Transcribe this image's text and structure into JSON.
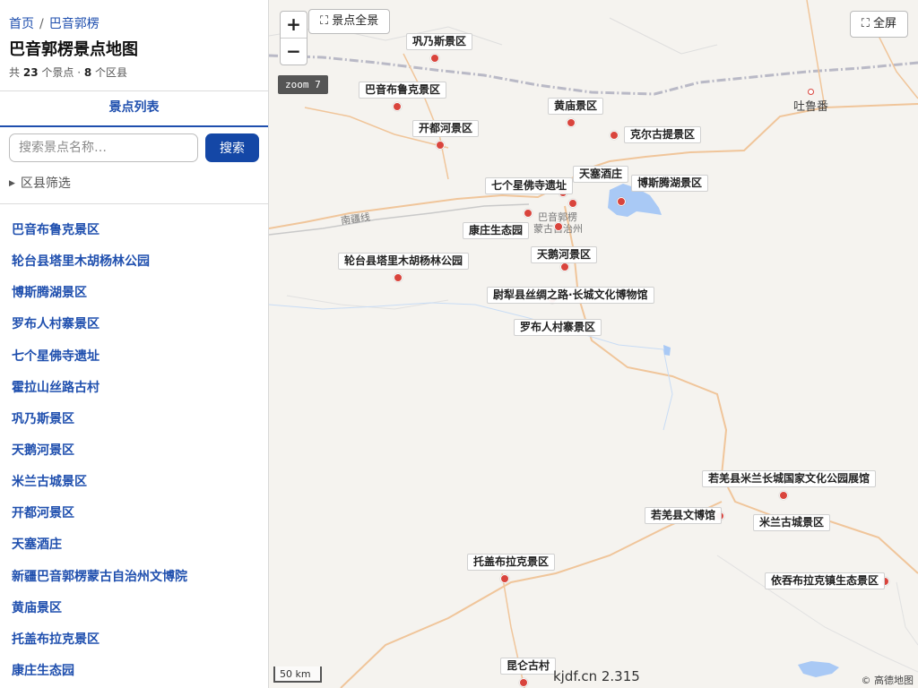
{
  "breadcrumb": {
    "home": "首页",
    "separator": "/",
    "current": "巴音郭楞"
  },
  "page_title": "巴音郭楞景点地图",
  "stats": {
    "prefix": "共",
    "spot_count": "23",
    "spot_unit": "个景点 ·",
    "county_count": "8",
    "county_unit": "个区县"
  },
  "tab": {
    "label": "景点列表"
  },
  "search": {
    "placeholder": "搜索景点名称…",
    "button": "搜索"
  },
  "filter": {
    "label": "区县筛选"
  },
  "places": [
    "巴音布鲁克景区",
    "轮台县塔里木胡杨林公园",
    "博斯腾湖景区",
    "罗布人村寨景区",
    "七个星佛寺遗址",
    "霍拉山丝路古村",
    "巩乃斯景区",
    "天鹅河景区",
    "米兰古城景区",
    "开都河景区",
    "天塞酒庄",
    "新疆巴音郭楞蒙古自治州文博院",
    "黄庙景区",
    "托盖布拉克景区",
    "康庄生态园"
  ],
  "map": {
    "zoom_in": "+",
    "zoom_out": "−",
    "overview_button": "⛶ 景点全景",
    "fullscreen_button": "⛶ 全屏",
    "zoom_label": "zoom 7",
    "scale": "50 km",
    "watermark": "kjdf.cn 2.315",
    "attribution": "© 高德地图",
    "road_label": "南疆线",
    "city": "吐鲁番",
    "capital_line1": "巴音郭楞",
    "capital_line2": "蒙古自治州",
    "labels": [
      "巩乃斯景区",
      "巴音布鲁克景区",
      "黄庙景区",
      "开都河景区",
      "克尔古提景区",
      "天塞酒庄",
      "七个星佛寺遗址",
      "博斯腾湖景区",
      "康庄生态园",
      "天鹅河景区",
      "轮台县塔里木胡杨林公园",
      "尉犁县丝绸之路·长城文化博物馆",
      "罗布人村寨景区",
      "若羌县米兰长城国家文化公园展馆",
      "若羌县文博馆",
      "米兰古城景区",
      "托盖布拉克景区",
      "依吞布拉克镇生态景区",
      "昆仑古村"
    ]
  },
  "colors": {
    "accent": "#1f4fae",
    "button": "#1447a6",
    "marker": "#d9443c",
    "map_bg": "#f5f3ef",
    "water": "#a9c9f5"
  }
}
